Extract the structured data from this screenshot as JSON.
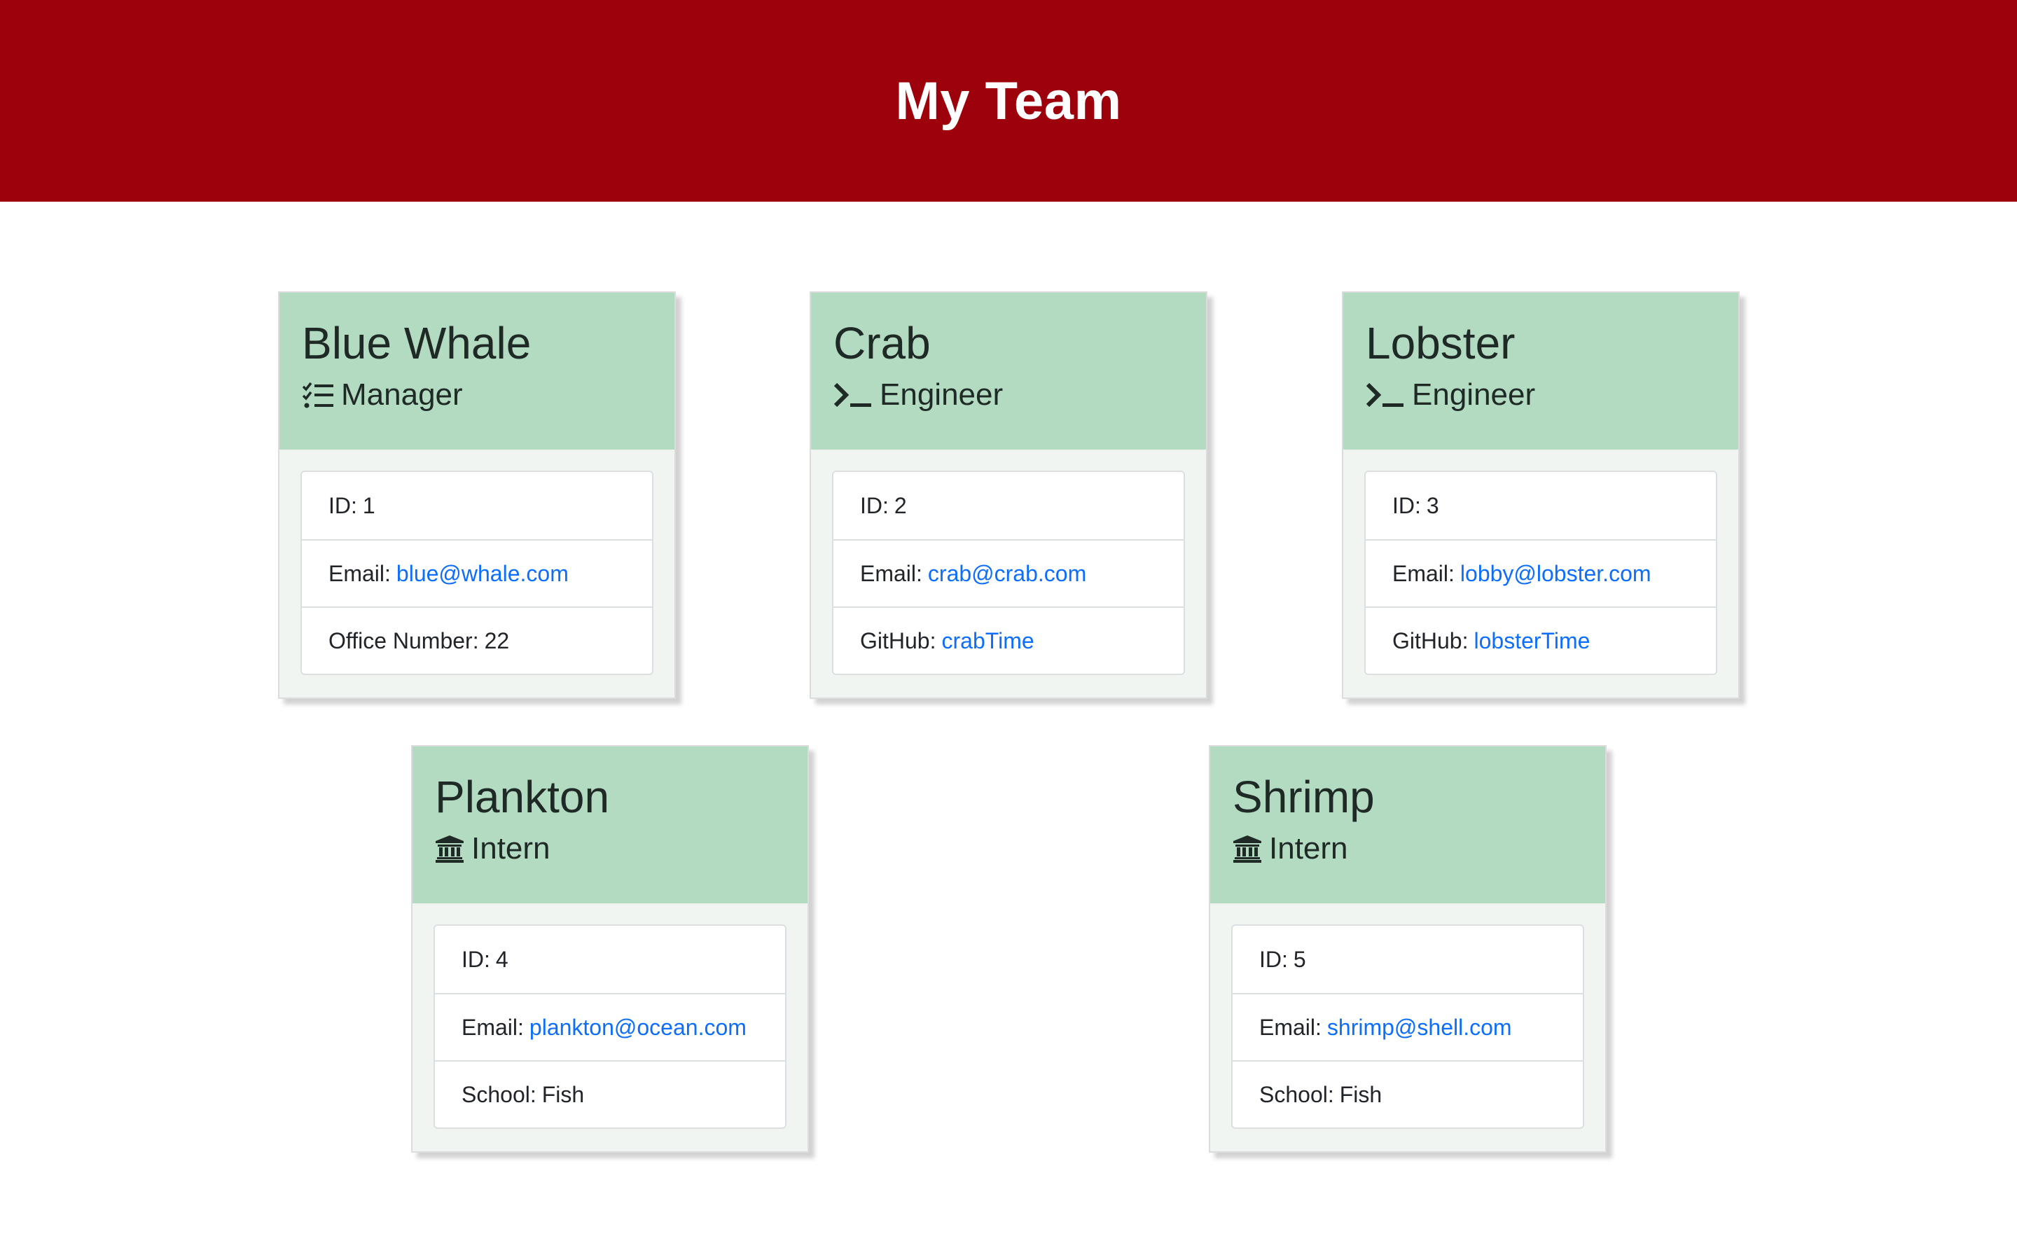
{
  "header": {
    "title": "My Team",
    "background": "#9d010b"
  },
  "colors": {
    "card_header": "#b3dbc1",
    "card_body": "#f0f5f2",
    "link": "#0d6efd"
  },
  "team": [
    {
      "name": "Blue Whale",
      "role": "Manager",
      "icon": "tasks-list-icon",
      "id_label": "ID:",
      "id_value": "1",
      "email_label": "Email:",
      "email": "blue@whale.com",
      "extra_label": "Office Number:",
      "extra_value": "22"
    },
    {
      "name": "Crab",
      "role": "Engineer",
      "icon": "terminal-icon",
      "id_label": "ID:",
      "id_value": "2",
      "email_label": "Email:",
      "email": "crab@crab.com",
      "extra_label": "GitHub:",
      "extra_value": "crabTime"
    },
    {
      "name": "Lobster",
      "role": "Engineer",
      "icon": "terminal-icon",
      "id_label": "ID:",
      "id_value": "3",
      "email_label": "Email:",
      "email": "lobby@lobster.com",
      "extra_label": "GitHub:",
      "extra_value": "lobsterTime"
    },
    {
      "name": "Plankton",
      "role": "Intern",
      "icon": "university-icon",
      "id_label": "ID:",
      "id_value": "4",
      "email_label": "Email:",
      "email": "plankton@ocean.com",
      "extra_label": "School:",
      "extra_value": "Fish"
    },
    {
      "name": "Shrimp",
      "role": "Intern",
      "icon": "university-icon",
      "id_label": "ID:",
      "id_value": "5",
      "email_label": "Email:",
      "email": "shrimp@shell.com",
      "extra_label": "School:",
      "extra_value": "Fish"
    }
  ]
}
